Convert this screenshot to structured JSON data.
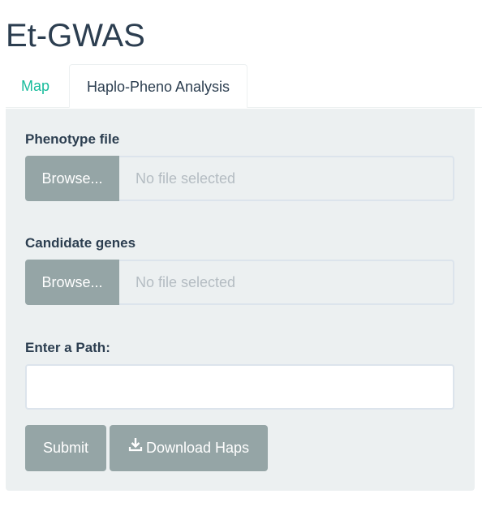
{
  "app": {
    "title": "Et-GWAS"
  },
  "tabs": [
    {
      "label": "Map",
      "active": false
    },
    {
      "label": "Haplo-Pheno Analysis",
      "active": true
    }
  ],
  "form": {
    "phenotype": {
      "label": "Phenotype file",
      "browse_label": "Browse...",
      "status": "No file selected"
    },
    "candidate": {
      "label": "Candidate genes",
      "browse_label": "Browse...",
      "status": "No file selected"
    },
    "path": {
      "label": "Enter a Path:",
      "value": ""
    },
    "submit_label": "Submit",
    "download_label": "Download Haps",
    "download_icon": "download-icon"
  },
  "colors": {
    "accent": "#18bc9c",
    "button": "#95a5a6",
    "panel": "#ecf0f1",
    "text": "#2c3e50"
  }
}
